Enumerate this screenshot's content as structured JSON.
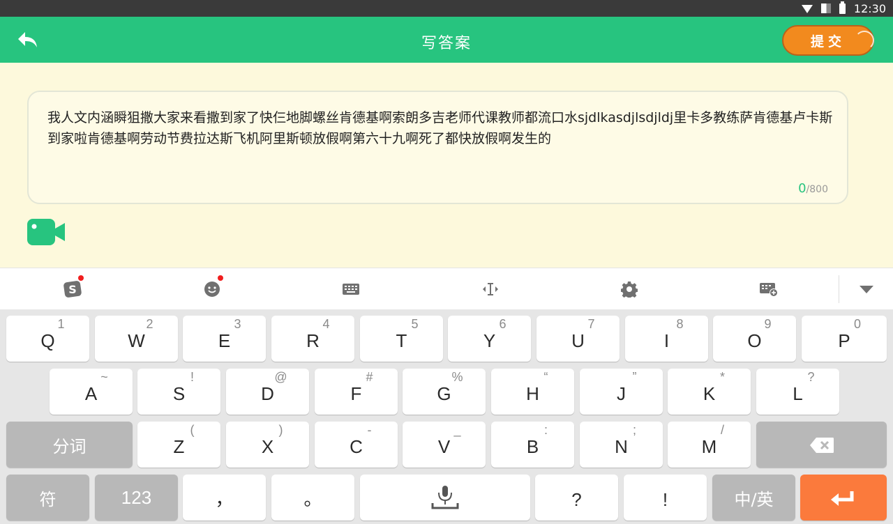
{
  "status_bar": {
    "time": "12:30"
  },
  "header": {
    "title": "写答案",
    "submit_label": "提交",
    "accent": "#27c47f",
    "submit_color": "#f28a1e"
  },
  "answer": {
    "text": "我人文内涵瞬狙撒大家来看撒到家了快仨地脚螺丝肯德基啊索朗多吉老师代课教师都流口水sjdlkasdjlsdjldj里卡多教练萨肯德基卢卡斯到家啦肯德基啊劳动节费拉达斯飞机阿里斯顿放假啊第六十九啊死了都快放假啊发生的",
    "count": "0",
    "max": "/800"
  },
  "keyboard_toolbar": {
    "icons": [
      "sogou-logo-icon",
      "emoji-icon",
      "keyboard-icon",
      "cursor-icon",
      "settings-icon",
      "keyboard-add-icon",
      "collapse-icon"
    ]
  },
  "keyboard": {
    "row1": [
      {
        "main": "Q",
        "sub": "1"
      },
      {
        "main": "W",
        "sub": "2"
      },
      {
        "main": "E",
        "sub": "3"
      },
      {
        "main": "R",
        "sub": "4"
      },
      {
        "main": "T",
        "sub": "5"
      },
      {
        "main": "Y",
        "sub": "6"
      },
      {
        "main": "U",
        "sub": "7"
      },
      {
        "main": "I",
        "sub": "8"
      },
      {
        "main": "O",
        "sub": "9"
      },
      {
        "main": "P",
        "sub": "0"
      }
    ],
    "row2": [
      {
        "main": "A",
        "sub": "~"
      },
      {
        "main": "S",
        "sub": "!"
      },
      {
        "main": "D",
        "sub": "@"
      },
      {
        "main": "F",
        "sub": "#"
      },
      {
        "main": "G",
        "sub": "%"
      },
      {
        "main": "H",
        "sub": "“"
      },
      {
        "main": "J",
        "sub": "”"
      },
      {
        "main": "K",
        "sub": "*"
      },
      {
        "main": "L",
        "sub": "?"
      }
    ],
    "row3": [
      {
        "main": "Z",
        "sub": "("
      },
      {
        "main": "X",
        "sub": ")"
      },
      {
        "main": "C",
        "sub": "-"
      },
      {
        "main": "V",
        "sub": "_"
      },
      {
        "main": "B",
        "sub": ":"
      },
      {
        "main": "N",
        "sub": ";"
      },
      {
        "main": "M",
        "sub": "/"
      }
    ],
    "fenci_label": "分词",
    "symbol_label": "符",
    "num_label": "123",
    "comma_label": "，",
    "period_label": "。",
    "question_label": "?",
    "exclaim_label": "!",
    "lang_label": "中/英",
    "enter_color": "#fb7a3c"
  }
}
